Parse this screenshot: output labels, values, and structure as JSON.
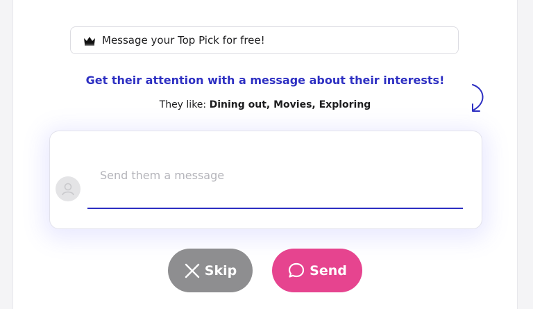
{
  "banner": {
    "icon": "crown-icon",
    "text": "Message your Top Pick for free!"
  },
  "prompt": {
    "headline": "Get their attention with a message about their interests!",
    "they_like_label": "They like:",
    "interests": "Dining out, Movies, Exploring"
  },
  "composer": {
    "placeholder": "Send them a message",
    "value": ""
  },
  "actions": {
    "skip_label": "Skip",
    "send_label": "Send"
  },
  "colors": {
    "accent": "#2d2fc2",
    "send": "#e6448f",
    "skip": "#8e8e90"
  }
}
